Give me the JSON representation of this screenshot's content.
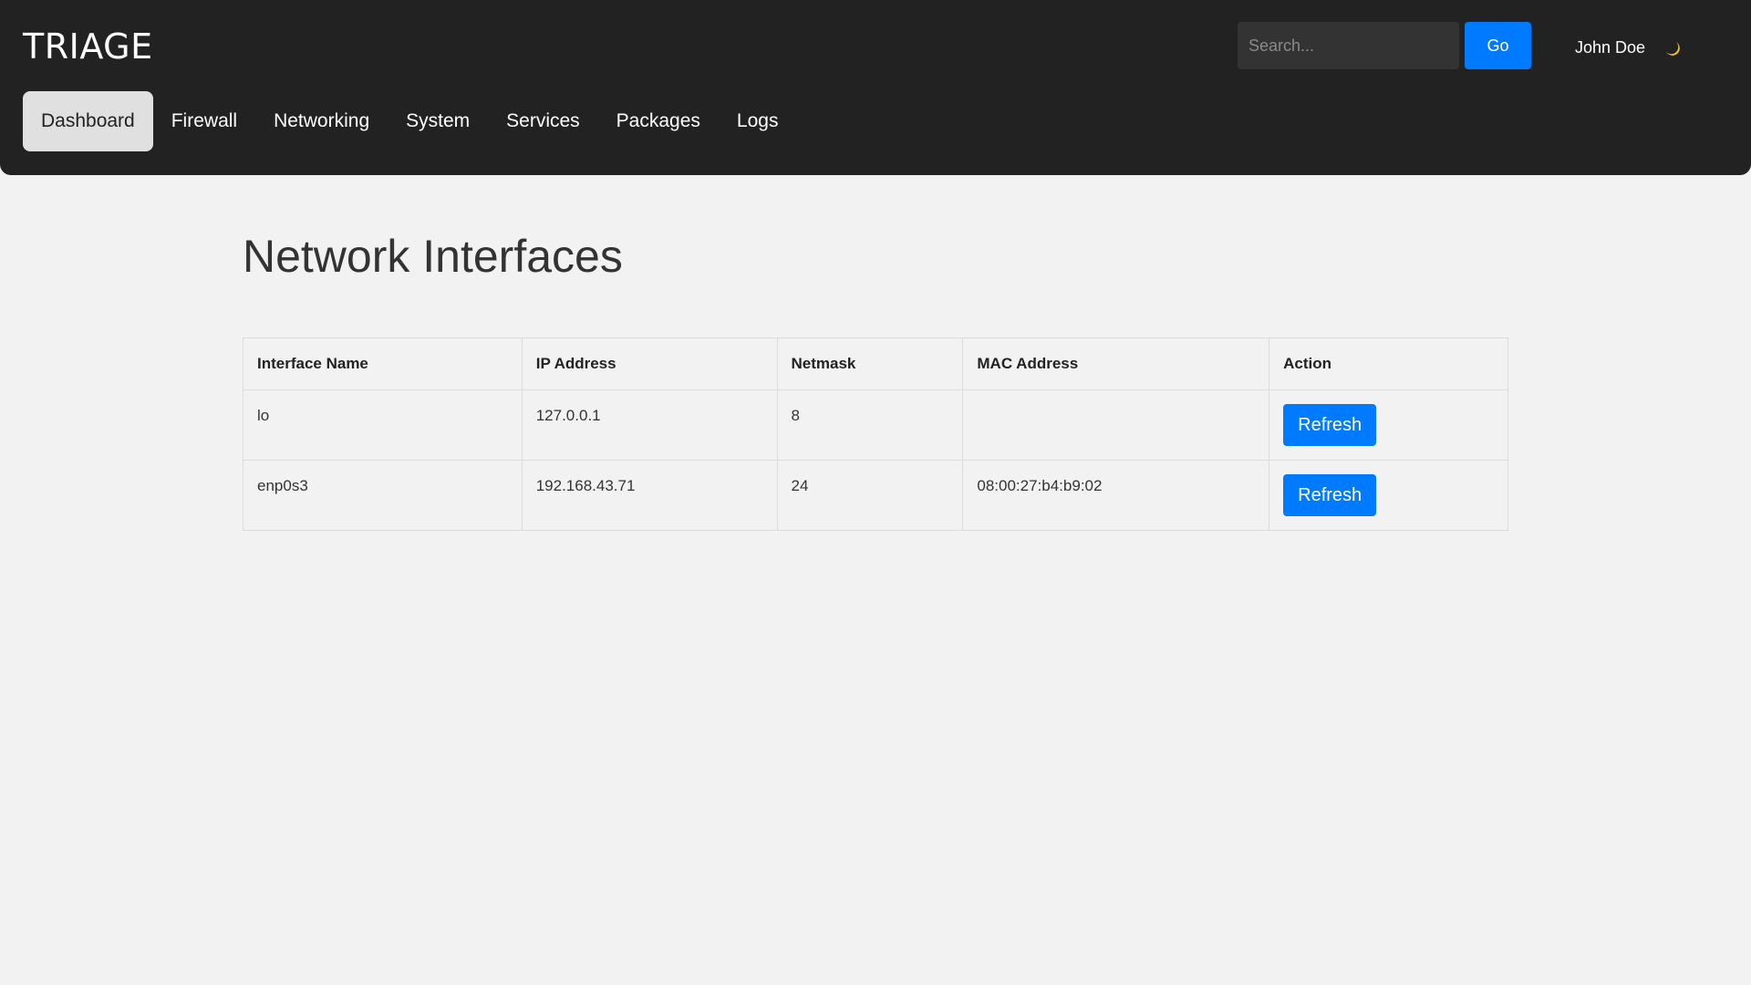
{
  "header": {
    "logo": "TRIAGE",
    "search": {
      "placeholder": "Search...",
      "value": ""
    },
    "go_label": "Go",
    "user_name": "John Doe",
    "theme_icon": "moon-icon"
  },
  "nav": {
    "items": [
      {
        "label": "Dashboard",
        "active": true
      },
      {
        "label": "Firewall",
        "active": false
      },
      {
        "label": "Networking",
        "active": false
      },
      {
        "label": "System",
        "active": false
      },
      {
        "label": "Services",
        "active": false
      },
      {
        "label": "Packages",
        "active": false
      },
      {
        "label": "Logs",
        "active": false
      }
    ]
  },
  "main": {
    "title": "Network Interfaces",
    "table": {
      "columns": [
        "Interface Name",
        "IP Address",
        "Netmask",
        "MAC Address",
        "Action"
      ],
      "rows": [
        {
          "name": "lo",
          "ip": "127.0.0.1",
          "netmask": "8",
          "mac": "",
          "action": "Refresh"
        },
        {
          "name": "enp0s3",
          "ip": "192.168.43.71",
          "netmask": "24",
          "mac": "08:00:27:b4:b9:02",
          "action": "Refresh"
        }
      ]
    }
  },
  "colors": {
    "topbar": "#222222",
    "accent": "#007bff",
    "background": "#f2f2f2",
    "moon": "#f5c518"
  }
}
